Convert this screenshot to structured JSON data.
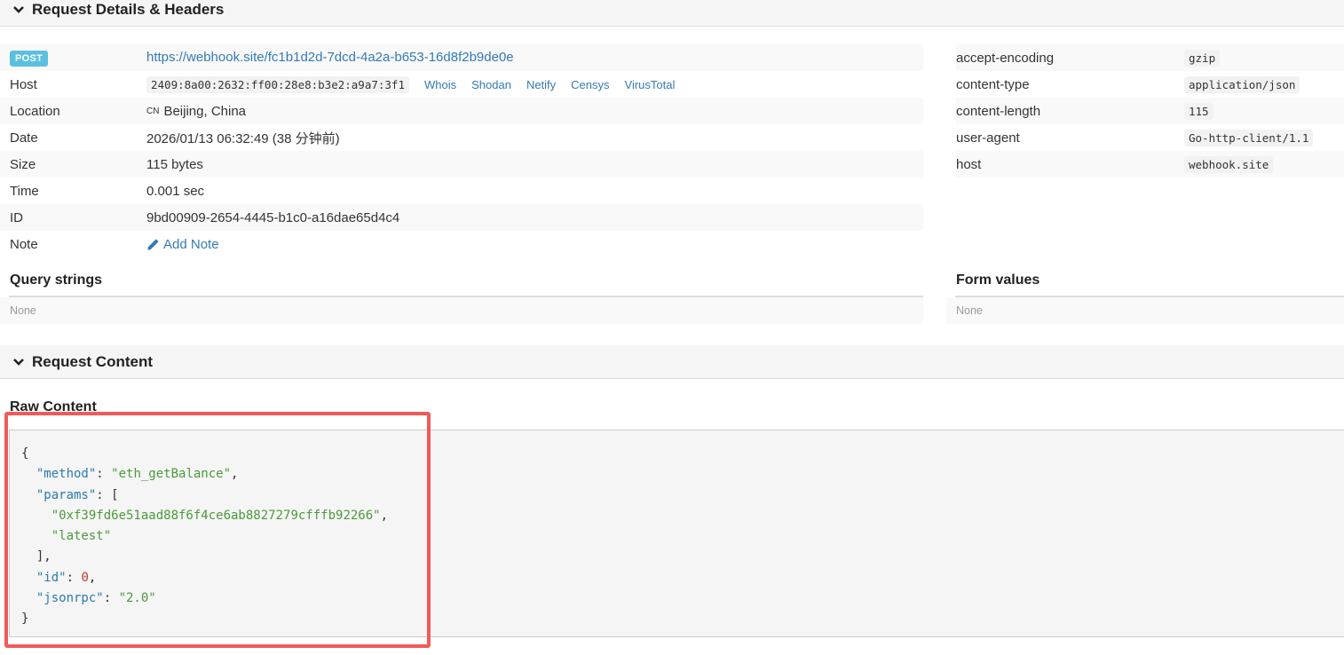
{
  "sections": {
    "details_title": "Request Details & Headers",
    "content_title": "Request Content"
  },
  "request": {
    "method": "POST",
    "url": "https://webhook.site/fc1b1d2d-7dcd-4a2a-b653-16d8f2b9de0e",
    "host_label": "Host",
    "host_value": "2409:8a00:2632:ff00:28e8:b3e2:a9a7:3f1",
    "host_links": [
      "Whois",
      "Shodan",
      "Netify",
      "Censys",
      "VirusTotal"
    ],
    "location_label": "Location",
    "location_flag": "CN",
    "location_value": "Beijing, China",
    "date_label": "Date",
    "date_value": "2026/01/13 06:32:49 (38 分钟前)",
    "size_label": "Size",
    "size_value": "115 bytes",
    "time_label": "Time",
    "time_value": "0.001 sec",
    "id_label": "ID",
    "id_value": "9bd00909-2654-4445-b1c0-a16dae65d4c4",
    "note_label": "Note",
    "note_action": "Add Note"
  },
  "headers": [
    {
      "key": "accept-encoding",
      "value": "gzip"
    },
    {
      "key": "content-type",
      "value": "application/json"
    },
    {
      "key": "content-length",
      "value": "115"
    },
    {
      "key": "user-agent",
      "value": "Go-http-client/1.1"
    },
    {
      "key": "host",
      "value": "webhook.site"
    }
  ],
  "query_strings": {
    "title": "Query strings",
    "value": "None"
  },
  "form_values": {
    "title": "Form values",
    "value": "None"
  },
  "raw_content": {
    "title": "Raw Content",
    "json": {
      "method_key": "\"method\"",
      "method_value": "\"eth_getBalance\"",
      "params_key": "\"params\"",
      "param_1": "\"0xf39fd6e51aad88f6f4ce6ab8827279cfffb92266\"",
      "param_2": "\"latest\"",
      "id_key": "\"id\"",
      "id_value": "0",
      "jsonrpc_key": "\"jsonrpc\"",
      "jsonrpc_value": "\"2.0\""
    }
  },
  "colors": {
    "accent": "#337ab7",
    "badge": "#5bc0de",
    "highlight": "#f05a5a",
    "json_key": "#2a7ab0",
    "json_string": "#4a9a3a",
    "json_number": "#c0392b"
  },
  "icons": {
    "collapse": "chevron-down-icon",
    "note": "pencil-icon"
  }
}
